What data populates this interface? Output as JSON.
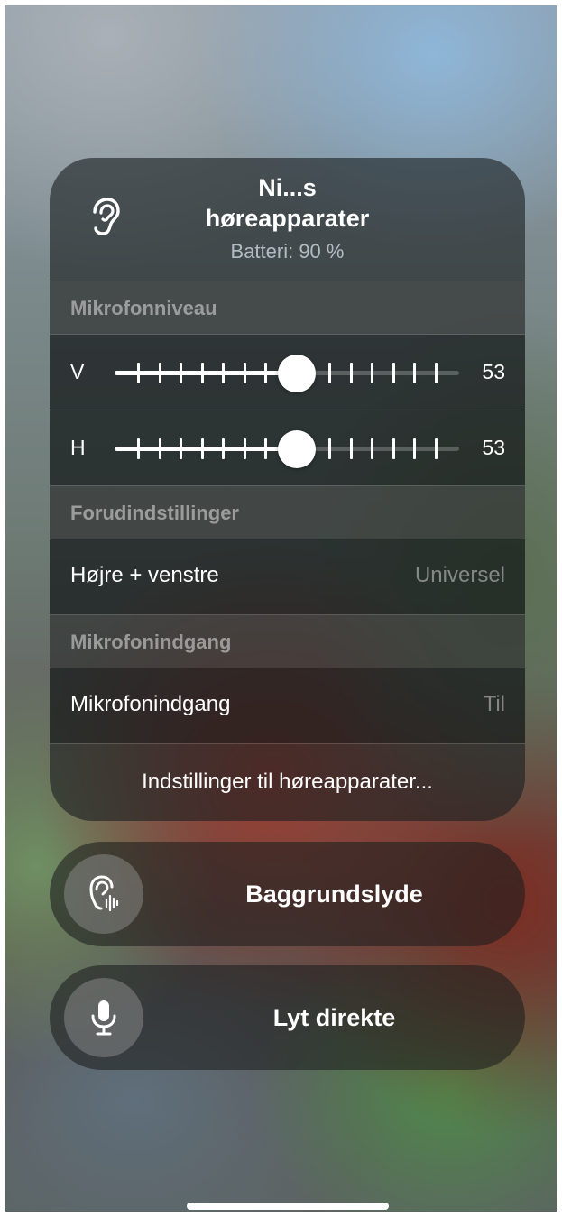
{
  "header": {
    "title_line1": "Ni...s",
    "title_line2": "høreapparater",
    "battery": "Batteri: 90 %"
  },
  "microphone_level": {
    "section_title": "Mikrofonniveau",
    "sliders": [
      {
        "side": "V",
        "value": "53",
        "level": 0.53
      },
      {
        "side": "H",
        "value": "53",
        "level": 0.53
      }
    ]
  },
  "presets": {
    "section_title": "Forudindstillinger",
    "label": "Højre + venstre",
    "value": "Universel"
  },
  "mic_input": {
    "section_title": "Mikrofonindgang",
    "label": "Mikrofonindgang",
    "value": "Til"
  },
  "settings_link": "Indstillinger til høreapparater...",
  "buttons": {
    "background_sounds": "Baggrundslyde",
    "live_listen": "Lyt direkte"
  },
  "icons": {
    "header": "ear-icon",
    "background_sounds": "ear-waveform-icon",
    "live_listen": "microphone-icon"
  }
}
